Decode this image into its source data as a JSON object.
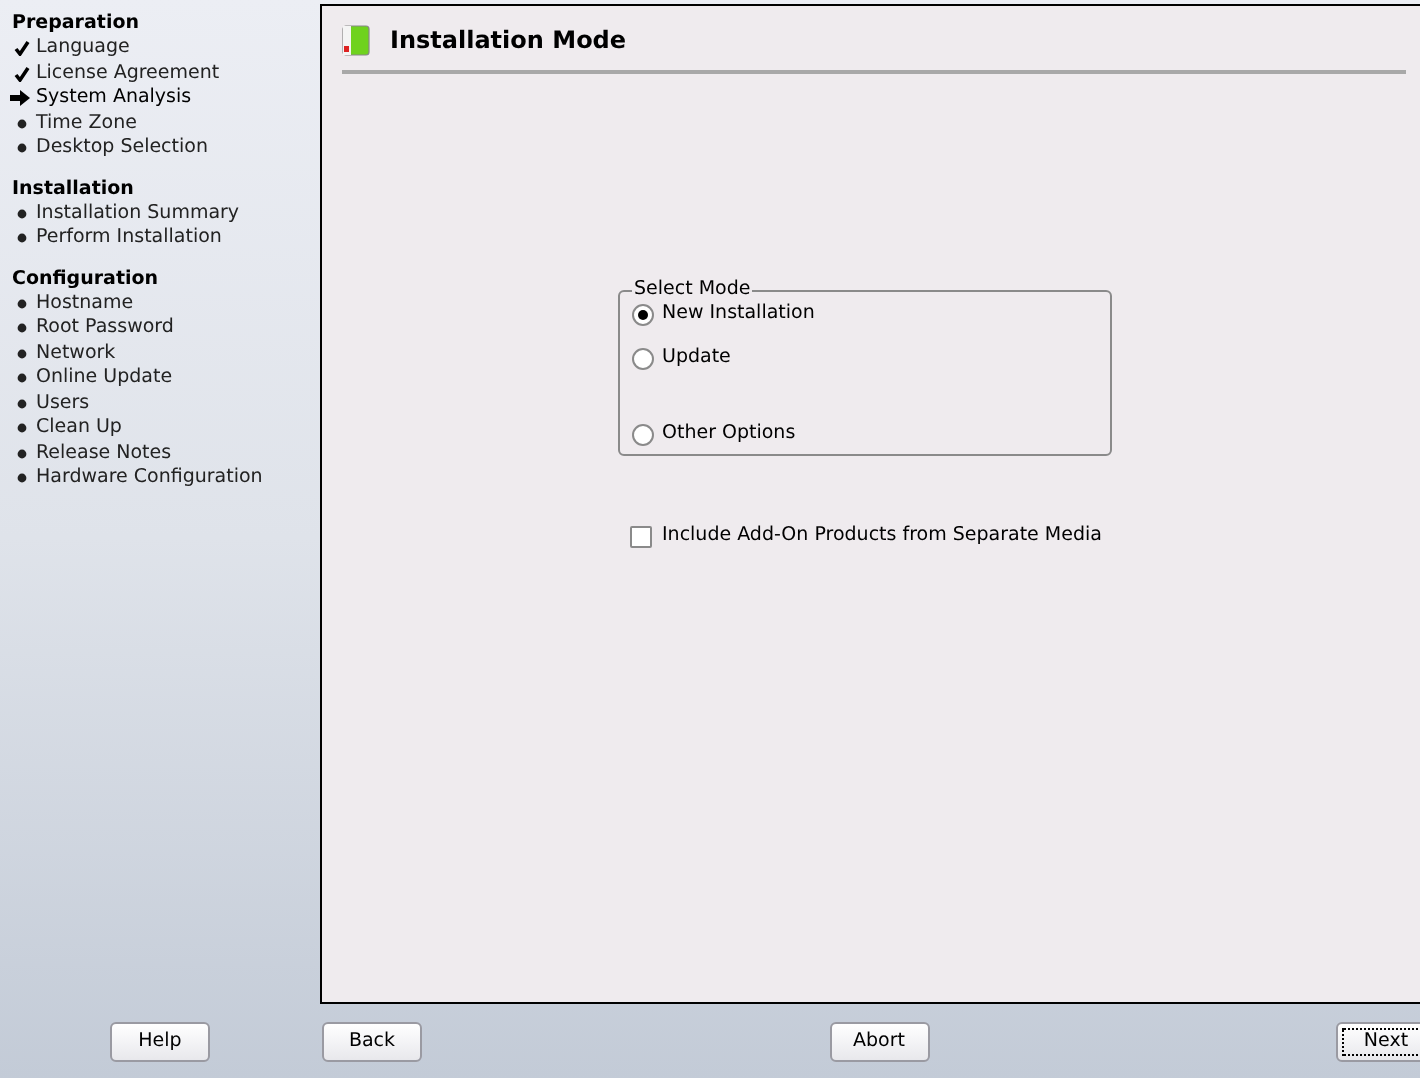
{
  "sidebar": {
    "sections": [
      {
        "title": "Preparation",
        "items": [
          {
            "label": "Language",
            "kind": "done"
          },
          {
            "label": "License Agreement",
            "kind": "done"
          },
          {
            "label": "System Analysis",
            "kind": "current"
          },
          {
            "label": "Time Zone",
            "kind": "pending"
          },
          {
            "label": "Desktop Selection",
            "kind": "pending"
          }
        ]
      },
      {
        "title": "Installation",
        "items": [
          {
            "label": "Installation Summary",
            "kind": "pending"
          },
          {
            "label": "Perform Installation",
            "kind": "pending"
          }
        ]
      },
      {
        "title": "Configuration",
        "items": [
          {
            "label": "Hostname",
            "kind": "pending"
          },
          {
            "label": "Root Password",
            "kind": "pending"
          },
          {
            "label": "Network",
            "kind": "pending"
          },
          {
            "label": "Online Update",
            "kind": "pending"
          },
          {
            "label": "Users",
            "kind": "pending"
          },
          {
            "label": "Clean Up",
            "kind": "pending"
          },
          {
            "label": "Release Notes",
            "kind": "pending"
          },
          {
            "label": "Hardware Configuration",
            "kind": "pending"
          }
        ]
      }
    ]
  },
  "page": {
    "title": "Installation Mode",
    "group": {
      "title": "Select Mode",
      "options": [
        {
          "label": "New Installation",
          "selected": true
        },
        {
          "label": "Update",
          "selected": false
        },
        {
          "label": "Other Options",
          "selected": false
        }
      ]
    },
    "checkbox": {
      "label": "Include Add-On Products from Separate Media",
      "checked": false
    }
  },
  "buttons": [
    {
      "label": "Help"
    },
    {
      "label": "Back"
    },
    {
      "label": "Abort"
    },
    {
      "label": "Next"
    }
  ]
}
